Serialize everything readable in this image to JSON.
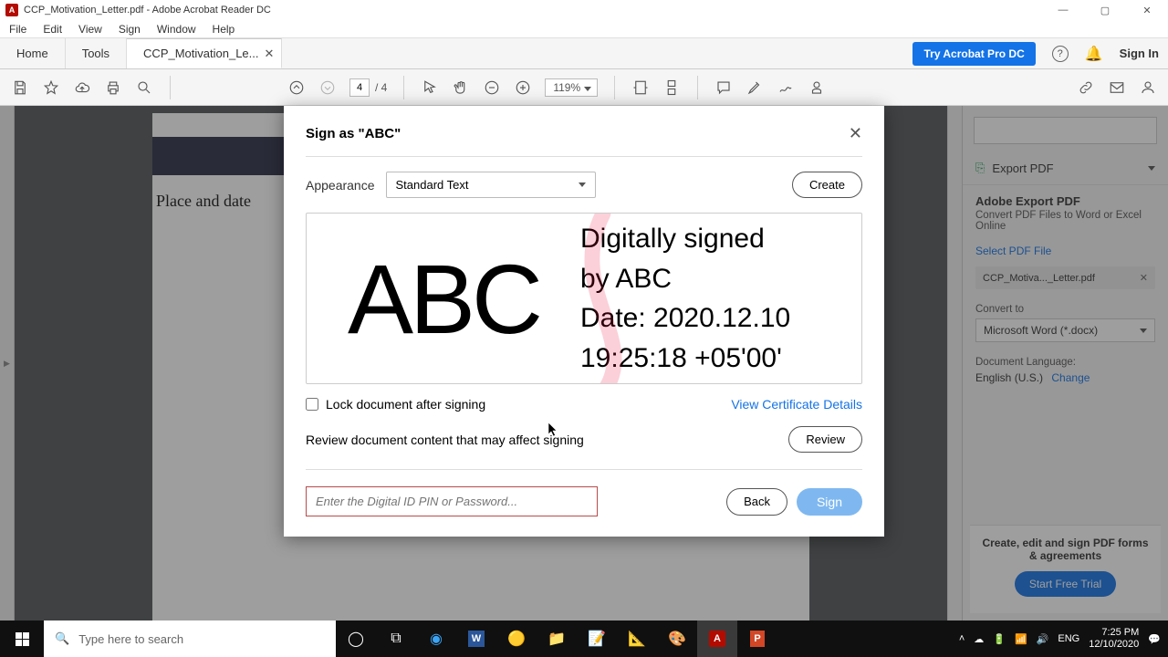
{
  "window": {
    "title": "CCP_Motivation_Letter.pdf - Adobe Acrobat Reader DC"
  },
  "menu": {
    "items": [
      "File",
      "Edit",
      "View",
      "Sign",
      "Window",
      "Help"
    ]
  },
  "tabs": {
    "home": "Home",
    "tools": "Tools",
    "doc": "CCP_Motivation_Le...",
    "try": "Try Acrobat Pro DC",
    "signin": "Sign In"
  },
  "toolbar": {
    "page_current": "4",
    "page_total": "/  4",
    "zoom": "119%"
  },
  "document": {
    "place_date": "Place and date"
  },
  "rightpanel": {
    "export": "Export PDF",
    "head": "Adobe Export PDF",
    "sub": "Convert PDF Files to Word or Excel Online",
    "select_label": "Select PDF File",
    "file": "CCP_Motiva..._Letter.pdf",
    "convert_label": "Convert to",
    "convert_value": "Microsoft Word (*.docx)",
    "lang_label": "Document Language:",
    "lang_value": "English (U.S.)",
    "lang_change": "Change",
    "cta_text": "Create, edit and sign PDF forms & agreements",
    "cta_btn": "Start Free Trial"
  },
  "dialog": {
    "title": "Sign as \"ABC\"",
    "appearance_label": "Appearance",
    "appearance_value": "Standard Text",
    "create": "Create",
    "sig_name": "ABC",
    "sig_line1": "Digitally signed",
    "sig_line2": "by ABC",
    "sig_line3": "Date: 2020.12.10",
    "sig_line4": "19:25:18 +05'00'",
    "lock": "Lock document after signing",
    "view_cert": "View Certificate Details",
    "review_text": "Review document content that may affect signing",
    "review_btn": "Review",
    "pin_placeholder": "Enter the Digital ID PIN or Password...",
    "back": "Back",
    "sign": "Sign"
  },
  "taskbar": {
    "search_placeholder": "Type here to search",
    "lang": "ENG",
    "time": "7:25 PM",
    "date": "12/10/2020"
  }
}
